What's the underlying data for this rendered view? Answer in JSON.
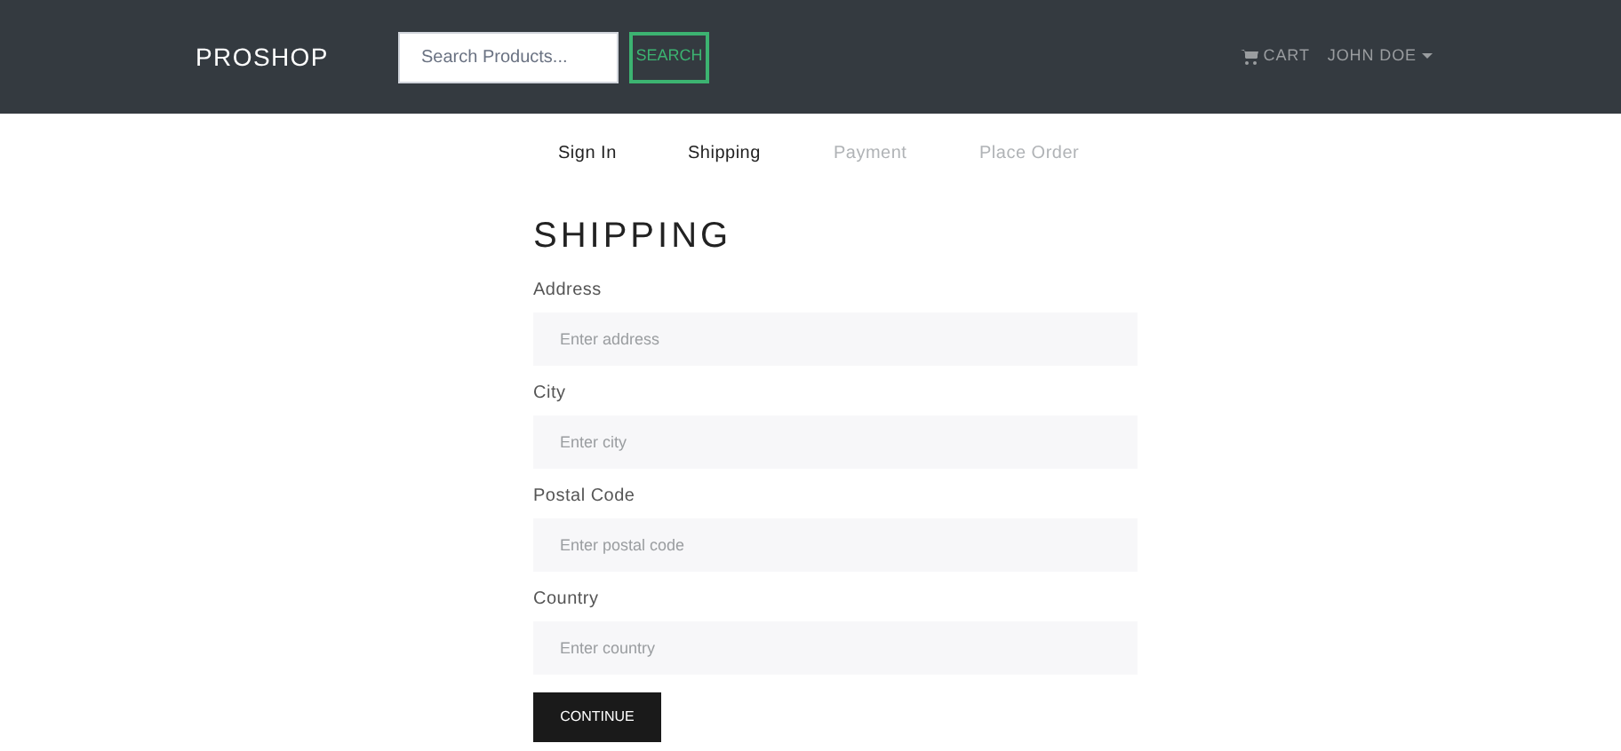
{
  "navbar": {
    "brand": "PROSHOP",
    "search": {
      "placeholder": "Search Products...",
      "button": "SEARCH"
    },
    "cart": "CART",
    "user": "JOHN DOE"
  },
  "steps": [
    {
      "label": "Sign In",
      "disabled": false
    },
    {
      "label": "Shipping",
      "disabled": false
    },
    {
      "label": "Payment",
      "disabled": true
    },
    {
      "label": "Place Order",
      "disabled": true
    }
  ],
  "form": {
    "title": "SHIPPING",
    "fields": [
      {
        "label": "Address",
        "placeholder": "Enter address"
      },
      {
        "label": "City",
        "placeholder": "Enter city"
      },
      {
        "label": "Postal Code",
        "placeholder": "Enter postal code"
      },
      {
        "label": "Country",
        "placeholder": "Enter country"
      }
    ],
    "submit": "CONTINUE"
  }
}
